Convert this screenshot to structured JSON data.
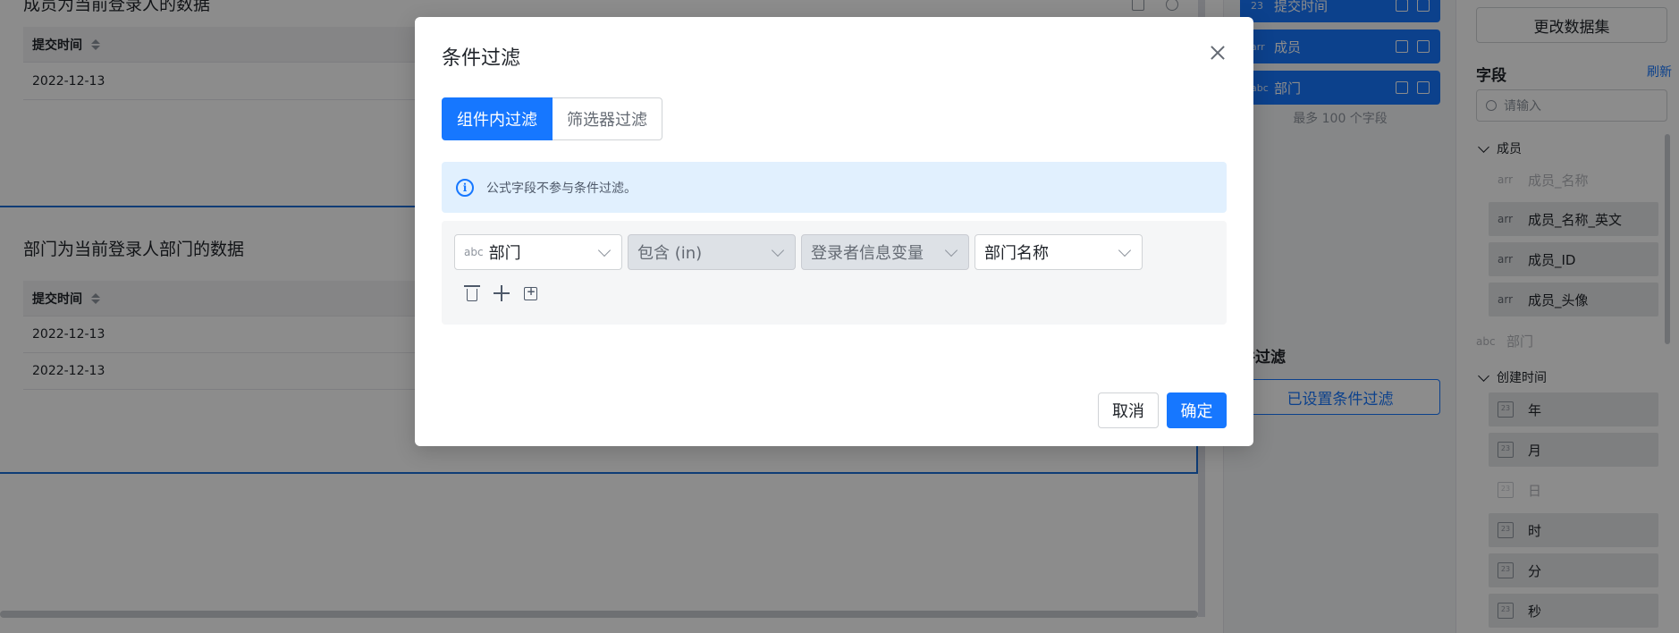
{
  "background": {
    "card1": {
      "title": "成员为当前登录人的数据",
      "column": "提交时间",
      "rows": [
        "2022-12-13"
      ]
    },
    "card2": {
      "title": "部门为当前登录人部门的数据",
      "column": "提交时间",
      "rows": [
        "2022-12-13",
        "2022-12-13"
      ]
    },
    "mid_panel": {
      "chips": [
        {
          "type": "23",
          "label": "提交时间"
        },
        {
          "type": "arr",
          "label": "成员"
        },
        {
          "type": "abc",
          "label": "部门"
        }
      ],
      "limit_note": "最多 100 个字段",
      "section_title": "件过滤",
      "filter_button": "已设置条件过滤"
    },
    "right_panel": {
      "change_dataset": "更改数据集",
      "fields_title": "字段",
      "refresh": "刷新",
      "search_placeholder": "请输入",
      "group_members": "成员",
      "member_fields": [
        {
          "type": "arr",
          "label": "成员_名称"
        },
        {
          "type": "arr",
          "label": "成员_名称_英文"
        },
        {
          "type": "arr",
          "label": "成员_ID"
        },
        {
          "type": "arr",
          "label": "成员_头像"
        }
      ],
      "dept_field": {
        "type": "abc",
        "label": "部门"
      },
      "group_created": "创建时间",
      "time_fields": [
        "年",
        "月",
        "日",
        "时",
        "分",
        "秒"
      ]
    }
  },
  "modal": {
    "title": "条件过滤",
    "tabs": {
      "active": "组件内过滤",
      "inactive": "筛选器过滤"
    },
    "info": "公式字段不参与条件过滤。",
    "condition": {
      "field_type": "abc",
      "field": "部门",
      "operator": "包含 (in)",
      "value_source": "登录者信息变量",
      "value": "部门名称"
    },
    "buttons": {
      "cancel": "取消",
      "ok": "确定"
    },
    "colors": {
      "primary": "#1677ff",
      "info_bg": "#e1f0fe"
    }
  }
}
